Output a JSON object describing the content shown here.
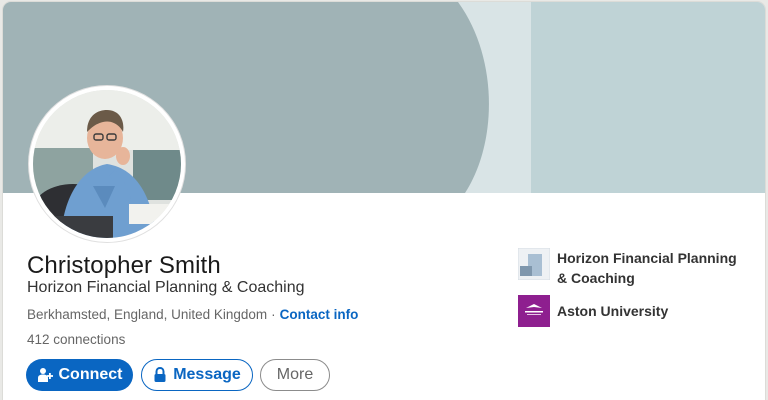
{
  "profile": {
    "name": "Christopher Smith",
    "headline": "Horizon Financial Planning & Coaching",
    "location": "Berkhamsted, England, United Kingdom",
    "separator": "·",
    "contact_info_label": "Contact info",
    "connections": "412 connections"
  },
  "actions": {
    "connect_label": "Connect",
    "message_label": "Message",
    "more_label": "More"
  },
  "affiliations": [
    {
      "label": "Horizon Financial Planning & Coaching",
      "logo": "horizon-logo"
    },
    {
      "label": "Aston University",
      "logo": "aston-university-logo"
    }
  ],
  "colors": {
    "accent": "#0a66c2",
    "banner_dark": "#a0b3b6",
    "banner_light": "#d9e4e6",
    "banner_right": "#bfd3d6",
    "aston_purple": "#8e1f8f"
  },
  "icons": {
    "connect": "person-add-icon",
    "message": "lock-icon"
  }
}
